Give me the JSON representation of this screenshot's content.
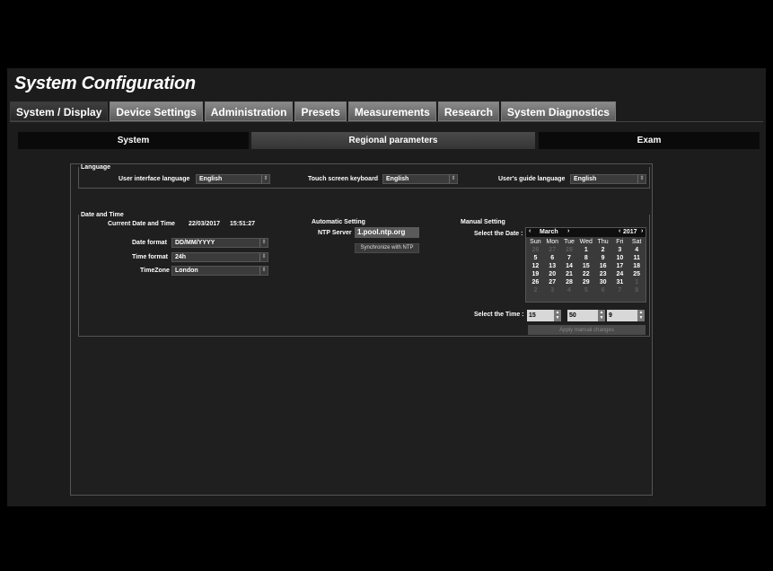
{
  "title": "System Configuration",
  "tabs": [
    "System / Display",
    "Device Settings",
    "Administration",
    "Presets",
    "Measurements",
    "Research",
    "System Diagnostics"
  ],
  "active_tab": "System / Display",
  "subtabs": [
    "System",
    "Regional parameters",
    "Exam"
  ],
  "selected_subtab": "Regional parameters",
  "language": {
    "title": "Language",
    "ui_label": "User interface language",
    "ui_value": "English",
    "touch_label": "Touch screen keyboard",
    "touch_value": "English",
    "guide_label": "User's guide language",
    "guide_value": "English"
  },
  "datetime": {
    "title": "Date and Time",
    "current_label": "Current Date and Time",
    "current_date": "22/03/2017",
    "current_time": "15:51:27",
    "date_format_label": "Date format",
    "date_format_value": "DD/MM/YYYY",
    "time_format_label": "Time format",
    "time_format_value": "24h",
    "timezone_label": "TimeZone",
    "timezone_value": "London"
  },
  "automatic": {
    "title": "Automatic Setting",
    "ntp_label": "NTP Server",
    "ntp_value": "1.pool.ntp.org",
    "sync_label": "Synchronize with NTP"
  },
  "manual": {
    "title": "Manual Setting",
    "date_label": "Select the Date :",
    "time_label": "Select the Time :",
    "hour": "15",
    "minute": "50",
    "second": "9",
    "apply_label": "Apply manual changes"
  },
  "calendar": {
    "month": "March",
    "year": "2017",
    "prev": "‹",
    "next": "›",
    "days": [
      "Sun",
      "Mon",
      "Tue",
      "Wed",
      "Thu",
      "Fri",
      "Sat"
    ],
    "weeks": [
      [
        "26",
        "27",
        "28",
        "1",
        "2",
        "3",
        "4"
      ],
      [
        "5",
        "6",
        "7",
        "8",
        "9",
        "10",
        "11"
      ],
      [
        "12",
        "13",
        "14",
        "15",
        "16",
        "17",
        "18"
      ],
      [
        "19",
        "20",
        "21",
        "22",
        "23",
        "24",
        "25"
      ],
      [
        "26",
        "27",
        "28",
        "29",
        "30",
        "31",
        "1"
      ],
      [
        "2",
        "3",
        "4",
        "5",
        "6",
        "7",
        "8"
      ]
    ],
    "other_month_mask": [
      [
        1,
        1,
        1,
        0,
        0,
        0,
        0
      ],
      [
        0,
        0,
        0,
        0,
        0,
        0,
        0
      ],
      [
        0,
        0,
        0,
        0,
        0,
        0,
        0
      ],
      [
        0,
        0,
        0,
        0,
        0,
        0,
        0
      ],
      [
        0,
        0,
        0,
        0,
        0,
        0,
        1
      ],
      [
        1,
        1,
        1,
        1,
        1,
        1,
        1
      ]
    ]
  }
}
